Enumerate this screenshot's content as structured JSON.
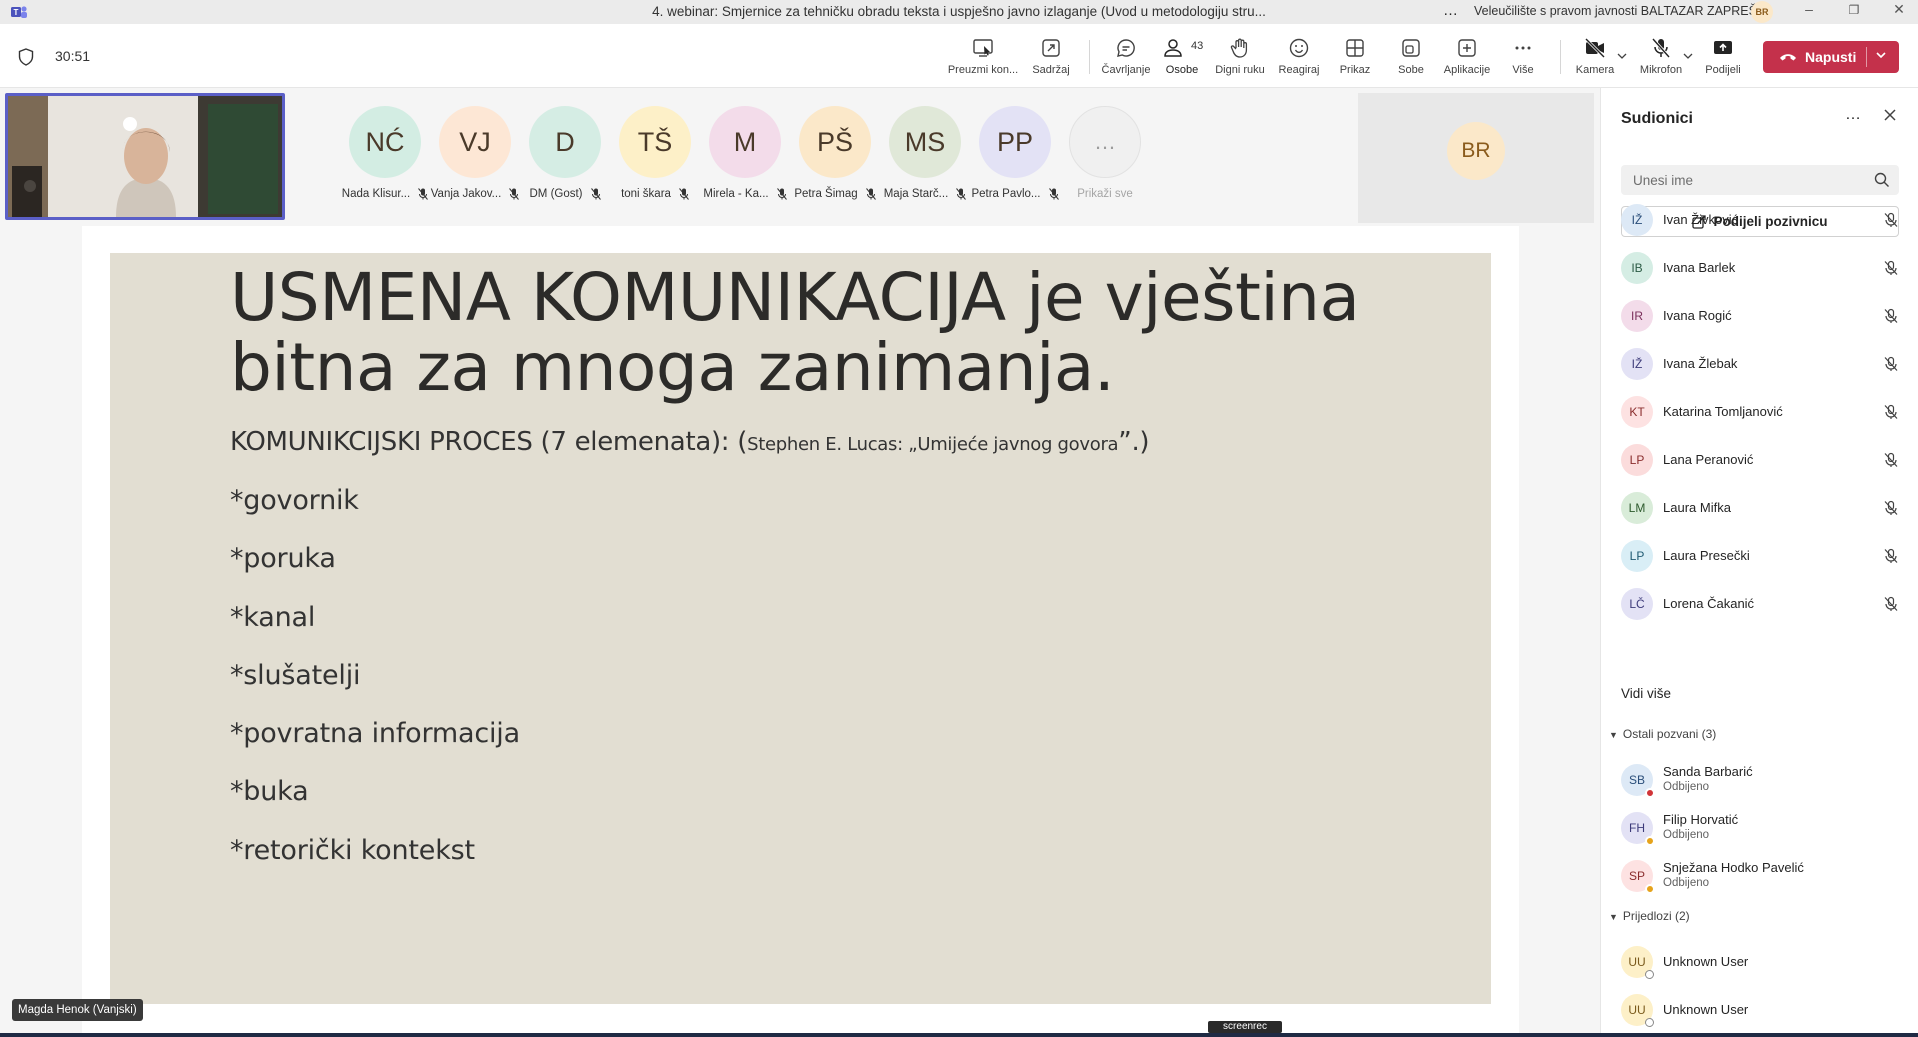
{
  "window": {
    "title": "4. webinar: Smjernice za tehničku obradu teksta i uspješno javno izlaganje (Uvod u metodologiju stru...",
    "more": "…",
    "org": "Veleučilište s pravom javnosti BALTAZAR ZAPREŠIĆ",
    "org_avatar": "BR",
    "minimize": "–",
    "restore": "❐",
    "close": "✕"
  },
  "toolbar": {
    "timer": "30:51",
    "tools": {
      "take_control": "Preuzmi kon...",
      "content": "Sadržaj",
      "chat": "Čavrljanje",
      "people": "Osobe",
      "people_count": "43",
      "raise_hand": "Digni ruku",
      "react": "Reagiraj",
      "view": "Prikaz",
      "rooms": "Sobe",
      "apps": "Aplikacije",
      "more": "Više",
      "camera": "Kamera",
      "mic": "Mikrofon",
      "share": "Podijeli"
    },
    "leave_label": "Napusti",
    "accent_color": "#5b5fc7",
    "leave_color": "#c4314b"
  },
  "stage": {
    "participants": [
      {
        "initials": "NĆ",
        "name": "Nada Klisur...",
        "color": "#d3ede3"
      },
      {
        "initials": "VJ",
        "name": "Vanja Jakov...",
        "color": "#fde7d5"
      },
      {
        "initials": "D",
        "name": "DM (Gost)",
        "color": "#d5ede4"
      },
      {
        "initials": "TŠ",
        "name": "toni škara",
        "color": "#fdf0c8"
      },
      {
        "initials": "M",
        "name": "Mirela - Ka...",
        "color": "#f3dcea"
      },
      {
        "initials": "PŠ",
        "name": "Petra Šimag",
        "color": "#fbe8c9"
      },
      {
        "initials": "MS",
        "name": "Maja Starč...",
        "color": "#e0e8d8"
      },
      {
        "initials": "PP",
        "name": "Petra Pavlo...",
        "color": "#e3e2f5"
      }
    ],
    "show_all": {
      "icon": "…",
      "label": "Prikaži sve"
    },
    "br_tile": "BR",
    "presenter_tag": "Magda Henok (Vanjski)",
    "rec_badge": "screenrec"
  },
  "slide": {
    "title_line1": "USMENA KOMUNIKACIJA je vještina",
    "title_line2": "bitna za mnoga zanimanja.",
    "subtitle": "KOMUNIKCIJSKI PROCES (7 elemenata): (",
    "subtitle_small": "Stephen E. Lucas: „Umijeće javnog govora",
    "subtitle_end": "”.)",
    "items": [
      "*govornik",
      "*poruka",
      "*kanal",
      "*slušatelji",
      "*povratna informacija",
      "*buka",
      "*retorički kontekst"
    ]
  },
  "panel": {
    "title": "Sudionici",
    "more": "…",
    "search_placeholder": "Unesi ime",
    "invite_label": "Podijeli pozivnicu",
    "people": [
      {
        "initials": "IŽ",
        "name": "Ivan Živković",
        "color": "#dde9f6",
        "fg": "#2a4e7a"
      },
      {
        "initials": "IB",
        "name": "Ivana Barlek",
        "color": "#d5ede4",
        "fg": "#2c5b45"
      },
      {
        "initials": "IR",
        "name": "Ivana Rogić",
        "color": "#f3dcea",
        "fg": "#7a2f5b"
      },
      {
        "initials": "IŽ",
        "name": "Ivana Žlebak",
        "color": "#e3e2f5",
        "fg": "#3d3b7a"
      },
      {
        "initials": "KT",
        "name": "Katarina Tomljanović",
        "color": "#fde2e2",
        "fg": "#8a2d2d"
      },
      {
        "initials": "LP",
        "name": "Lana Peranović",
        "color": "#fbdcdc",
        "fg": "#8a2d2d"
      },
      {
        "initials": "LM",
        "name": "Laura Mifka",
        "color": "#d9ecd9",
        "fg": "#2d5a2d"
      },
      {
        "initials": "LP",
        "name": "Laura Presečki",
        "color": "#d9eef6",
        "fg": "#1f5a72"
      },
      {
        "initials": "LČ",
        "name": "Lorena Čakanić",
        "color": "#e3e2f5",
        "fg": "#3d3b7a"
      }
    ],
    "see_more": "Vidi više",
    "others_header": "Ostali pozvani (3)",
    "others": [
      {
        "initials": "SB",
        "name": "Sanda Barbarić",
        "status": "Odbijeno",
        "color": "#dde9f6",
        "fg": "#2a4e7a",
        "dot": "#d13438"
      },
      {
        "initials": "FH",
        "name": "Filip Horvatić",
        "status": "Odbijeno",
        "color": "#e3e2f5",
        "fg": "#3d3b7a",
        "dot": "#e6a31b"
      },
      {
        "initials": "SP",
        "name": "Snježana Hodko Pavelić",
        "status": "Odbijeno",
        "color": "#fde2e2",
        "fg": "#8a2d2d",
        "dot": "#e6a31b"
      }
    ],
    "suggestions_header": "Prijedlozi (2)",
    "suggestions": [
      {
        "initials": "UU",
        "name": "Unknown User",
        "color": "#fdf0c8",
        "fg": "#7a5a1c"
      },
      {
        "initials": "UU",
        "name": "Unknown User",
        "color": "#fdf0c8",
        "fg": "#7a5a1c"
      }
    ]
  }
}
